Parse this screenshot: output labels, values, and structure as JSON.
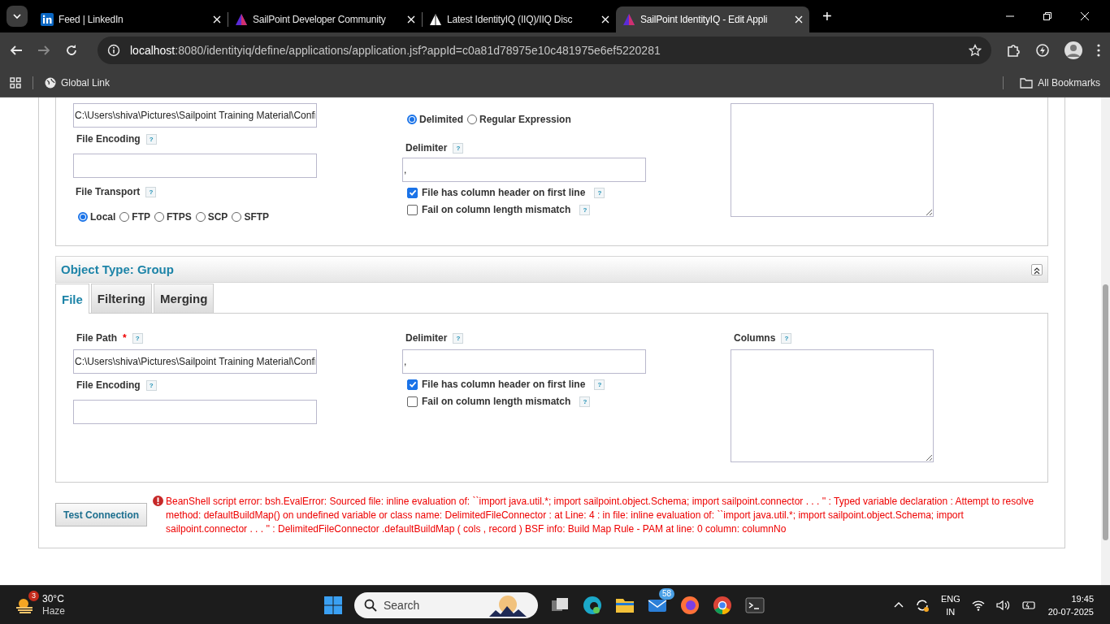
{
  "browser": {
    "tabs": [
      {
        "title": "Feed | LinkedIn",
        "kind": "linkedin",
        "selected": false
      },
      {
        "title": "SailPoint Developer Community",
        "kind": "sailpoint",
        "selected": false
      },
      {
        "title": "Latest IdentityIQ (IIQ)/IIQ Disc",
        "kind": "sail",
        "selected": false
      },
      {
        "title": "SailPoint IdentityIQ - Edit Appli",
        "kind": "sailpoint",
        "selected": true
      }
    ],
    "new_tab": "+",
    "address": {
      "host": "localhost",
      "rest": ":8080/identityiq/define/applications/application.jsf?appId=c0a81d78975e10c481975e6ef5220281"
    },
    "bookmarks": [
      {
        "label": "Global Link"
      }
    ],
    "all_bookmarks": "All Bookmarks"
  },
  "top_section": {
    "file_path_value": "C:\\Users\\shiva\\Pictures\\Sailpoint Training Material\\Confi",
    "file_encoding_label": "File Encoding",
    "file_encoding_help": "?",
    "file_transport_label": "File Transport",
    "file_transport_help": "?",
    "transports": [
      {
        "label": "Local",
        "selected": true
      },
      {
        "label": "FTP",
        "selected": false
      },
      {
        "label": "FTPS",
        "selected": false
      },
      {
        "label": "SCP",
        "selected": false
      },
      {
        "label": "SFTP",
        "selected": false
      }
    ],
    "parsing_types": [
      {
        "label": "Delimited",
        "selected": true
      },
      {
        "label": "Regular Expression",
        "selected": false
      }
    ],
    "delimiter_label": "Delimiter",
    "delimiter_help": "?",
    "delimiter_value": ",",
    "checkboxes": [
      {
        "label": "File has column header on first line",
        "help": "?",
        "checked": true
      },
      {
        "label": "Fail on column length mismatch",
        "help": "?",
        "checked": false
      }
    ]
  },
  "group_section": {
    "title": "Object Type: Group",
    "expanded": true,
    "tabs": [
      {
        "label": "File",
        "selected": true
      },
      {
        "label": "Filtering",
        "selected": false
      },
      {
        "label": "Merging",
        "selected": false
      }
    ],
    "file_path_label": "File Path",
    "required_mark": "*",
    "file_path_help": "?",
    "file_path_value": "C:\\Users\\shiva\\Pictures\\Sailpoint Training Material\\Confi",
    "file_encoding_label": "File Encoding",
    "file_encoding_help": "?",
    "delimiter_label": "Delimiter",
    "delimiter_help": "?",
    "delimiter_value": ",",
    "checkboxes": [
      {
        "label": "File has column header on first line",
        "help": "?",
        "checked": true
      },
      {
        "label": "Fail on column length mismatch",
        "help": "?",
        "checked": false
      }
    ],
    "columns_label": "Columns",
    "columns_help": "?"
  },
  "test_button": "Test Connection",
  "error_message": "BeanShell script error: bsh.EvalError: Sourced file: inline evaluation of: ``import java.util.*; import sailpoint.object.Schema; import sailpoint.connector . . . '' : Typed variable declaration : Attempt to resolve method: defaultBuildMap() on undefined variable or class name: DelimitedFileConnector : at Line: 4 : in file: inline evaluation of: ``import java.util.*; import sailpoint.object.Schema; import sailpoint.connector . . . '' : DelimitedFileConnector .defaultBuildMap ( cols , record ) BSF info: Build Map Rule - PAM at line: 0 column: columnNo",
  "taskbar": {
    "weather": {
      "badge": "3",
      "temp": "30°C",
      "condition": "Haze"
    },
    "search_placeholder": "Search",
    "mail_badge": "58",
    "language": [
      "ENG",
      "IN"
    ],
    "time": "19:45",
    "date": "20-07-2025"
  }
}
